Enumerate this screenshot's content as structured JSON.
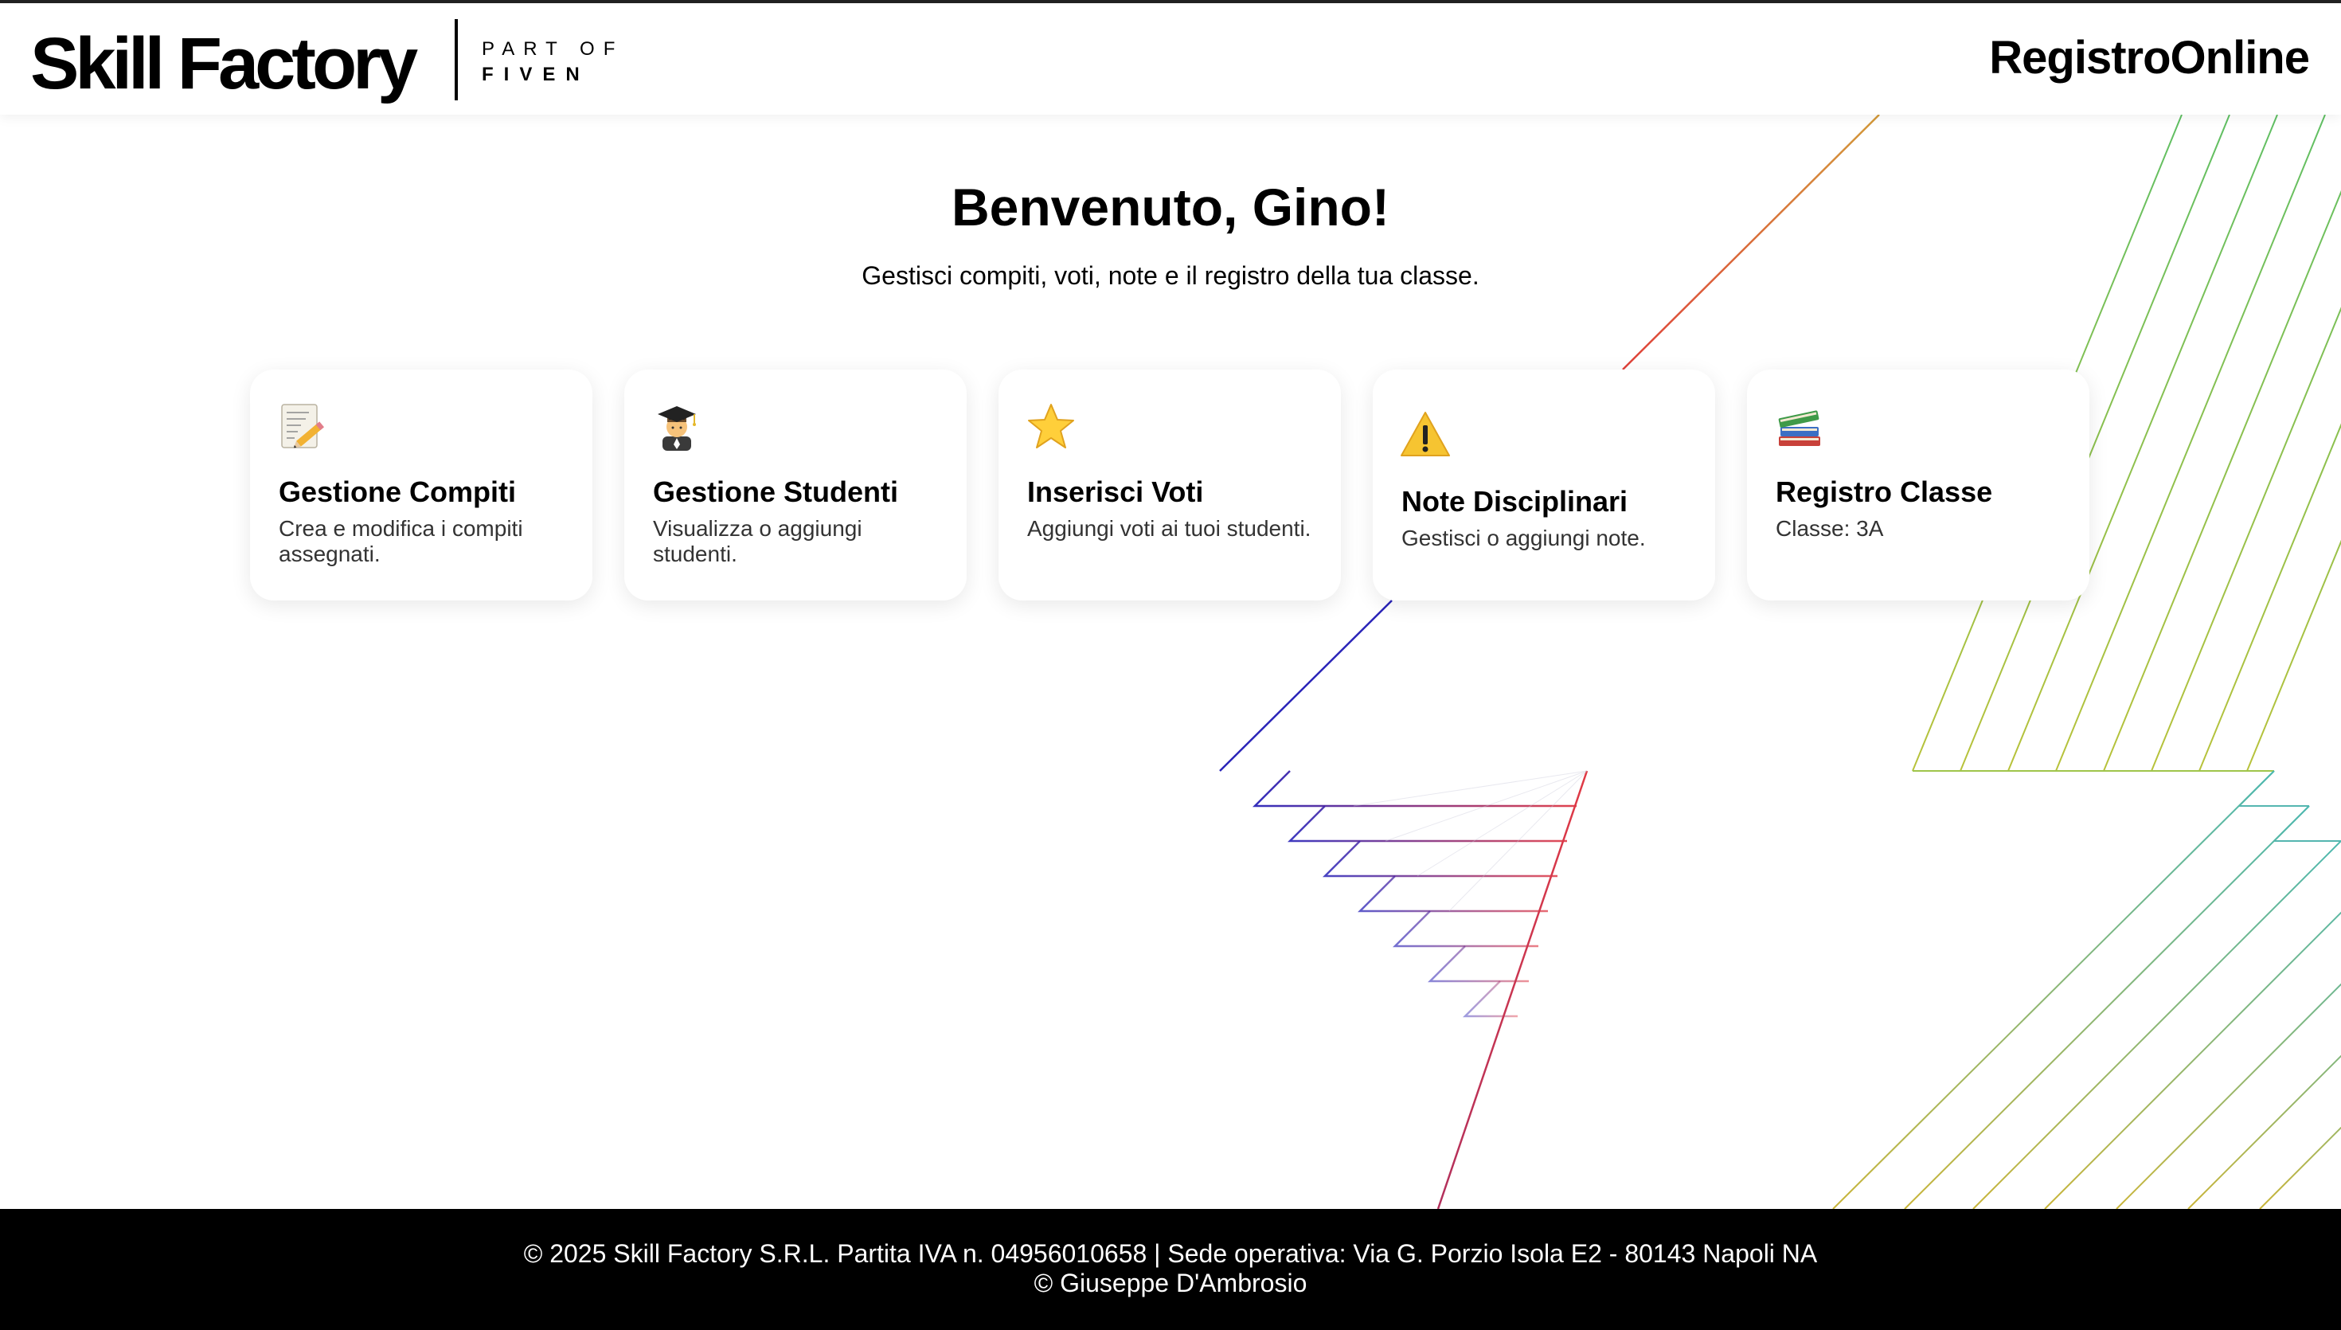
{
  "header": {
    "logo_text": "Skill Factory",
    "logo_part_of": "PART OF",
    "logo_fiven": "FIVEN",
    "brand": "RegistroOnline"
  },
  "main": {
    "welcome": "Benvenuto, Gino!",
    "subtitle": "Gestisci compiti, voti, note e il registro della tua classe."
  },
  "cards": [
    {
      "icon": "memo-icon",
      "title": "Gestione Compiti",
      "description": "Crea e modifica i compiti assegnati."
    },
    {
      "icon": "student-icon",
      "title": "Gestione Studenti",
      "description": "Visualizza o aggiungi studenti."
    },
    {
      "icon": "star-icon",
      "title": "Inserisci Voti",
      "description": "Aggiungi voti ai tuoi studenti."
    },
    {
      "icon": "warning-icon",
      "title": "Note Disciplinari",
      "description": "Gestisci o aggiungi note."
    },
    {
      "icon": "books-icon",
      "title": "Registro Classe",
      "description": "Classe: 3A"
    }
  ],
  "footer": {
    "line1": "© 2025 Skill Factory S.R.L. Partita IVA n. 04956010658 | Sede operativa: Via G. Porzio Isola E2 - 80143 Napoli NA",
    "line2": "© Giuseppe D'Ambrosio"
  },
  "colors": {
    "header_bg": "#ffffff",
    "footer_bg": "#000000",
    "card_bg": "#ffffff",
    "line_blue": "#2a24b8",
    "line_red": "#d9354a",
    "line_green": "#6abd55",
    "line_teal": "#3fb0b8"
  }
}
